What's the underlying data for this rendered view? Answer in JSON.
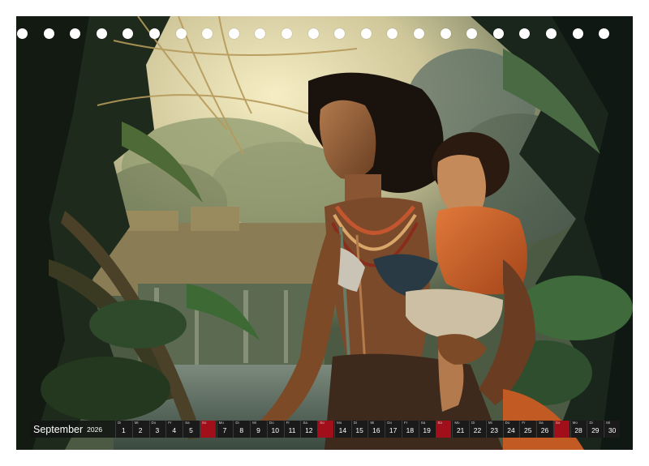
{
  "artwork": {
    "subject": "painting-mother-and-child-in-jungle"
  },
  "ring_binding": {
    "hole_count": 23
  },
  "calendar": {
    "month": "September",
    "year": "2026",
    "days": [
      {
        "weekday": "Di",
        "day": "1"
      },
      {
        "weekday": "Mi",
        "day": "2"
      },
      {
        "weekday": "Do",
        "day": "3"
      },
      {
        "weekday": "Fr",
        "day": "4"
      },
      {
        "weekday": "Sa",
        "day": "5"
      },
      {
        "weekday": "So",
        "day": "6",
        "holiday": true
      },
      {
        "weekday": "Mo",
        "day": "7"
      },
      {
        "weekday": "Di",
        "day": "8"
      },
      {
        "weekday": "Mi",
        "day": "9"
      },
      {
        "weekday": "Do",
        "day": "10"
      },
      {
        "weekday": "Fr",
        "day": "11"
      },
      {
        "weekday": "Sa",
        "day": "12"
      },
      {
        "weekday": "So",
        "day": "13",
        "holiday": true
      },
      {
        "weekday": "Mo",
        "day": "14"
      },
      {
        "weekday": "Di",
        "day": "15"
      },
      {
        "weekday": "Mi",
        "day": "16"
      },
      {
        "weekday": "Do",
        "day": "17"
      },
      {
        "weekday": "Fr",
        "day": "18"
      },
      {
        "weekday": "Sa",
        "day": "19"
      },
      {
        "weekday": "So",
        "day": "20",
        "holiday": true
      },
      {
        "weekday": "Mo",
        "day": "21"
      },
      {
        "weekday": "Di",
        "day": "22"
      },
      {
        "weekday": "Mi",
        "day": "23"
      },
      {
        "weekday": "Do",
        "day": "24"
      },
      {
        "weekday": "Fr",
        "day": "25"
      },
      {
        "weekday": "Sa",
        "day": "26"
      },
      {
        "weekday": "So",
        "day": "27",
        "holiday": true
      },
      {
        "weekday": "Mo",
        "day": "28"
      },
      {
        "weekday": "Di",
        "day": "29"
      },
      {
        "weekday": "Mi",
        "day": "30"
      }
    ],
    "colors": {
      "strip": "#121412",
      "weekday_cell": "#1a1a1a",
      "sunday_cell": "#a1101a",
      "text": "#ffffff"
    }
  }
}
